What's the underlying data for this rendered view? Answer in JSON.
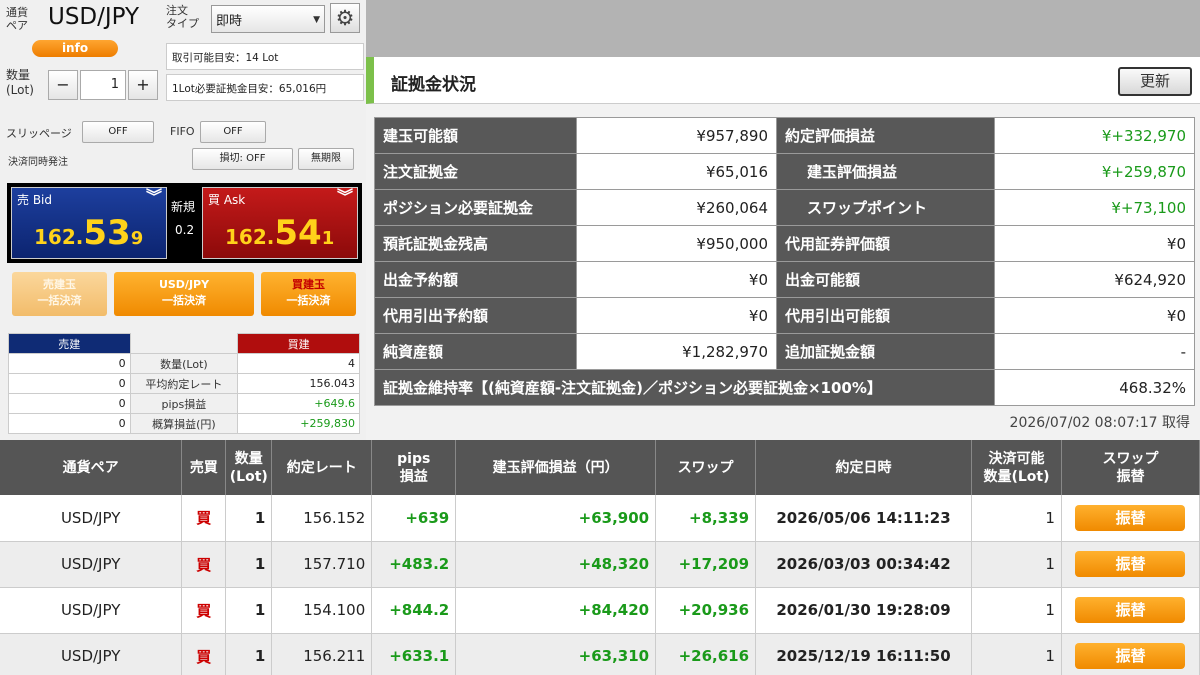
{
  "order": {
    "pair_label": "通貨\nペア",
    "pair": "USD/JPY",
    "info_label": "info",
    "order_type_label": "注文\nタイプ",
    "order_type_value": "即時",
    "tradable_lot": "取引可能目安：14 Lot",
    "required_margin": "1Lot必要証拠金目安：65,016円",
    "qty_label": "数量\n(Lot)",
    "qty_value": "1",
    "minus": "−",
    "plus": "+",
    "slippage_label": "スリッページ",
    "slippage_value": "OFF",
    "fifo_label": "FIFO",
    "fifo_value": "OFF",
    "settle_label": "決済同時発注",
    "stoploss_value": "損切: OFF",
    "expiry_value": "無期限"
  },
  "quote": {
    "bid_title": "売 Bid",
    "bid_base": "162.",
    "bid_big": "53",
    "bid_small": "9",
    "ask_title": "買 Ask",
    "ask_base": "162.",
    "ask_big": "54",
    "ask_small": "1",
    "new_label": "新規",
    "spread": "0.2"
  },
  "bulk": {
    "sell_l1": "売建玉",
    "sell_l2": "一括決済",
    "pair_l1": "USD/JPY",
    "pair_l2": "一括決済",
    "buy_l1": "買建玉",
    "buy_l2": "一括決済"
  },
  "summary": {
    "sell_header": "売建",
    "buy_header": "買建",
    "rows": [
      {
        "sell": "0",
        "label": "数量(Lot)",
        "buy": "4"
      },
      {
        "sell": "0",
        "label": "平均約定レート",
        "buy": "156.043"
      },
      {
        "sell": "0",
        "label": "pips損益",
        "buy": "+649.6"
      },
      {
        "sell": "0",
        "label": "概算損益(円)",
        "buy": "+259,830"
      }
    ]
  },
  "margin": {
    "title": "証拠金状況",
    "refresh": "更新",
    "rows": [
      {
        "l1": "建玉可能額",
        "v1": "¥957,890",
        "l2": "約定評価損益",
        "v2": "¥+332,970"
      },
      {
        "l1": "注文証拠金",
        "v1": "¥65,016",
        "l2": "建玉評価損益",
        "v2": "¥+259,870"
      },
      {
        "l1": "ポジション必要証拠金",
        "v1": "¥260,064",
        "l2": "スワップポイント",
        "v2": "¥+73,100"
      },
      {
        "l1": "預託証拠金残高",
        "v1": "¥950,000",
        "l2": "代用証券評価額",
        "v2": "¥0"
      },
      {
        "l1": "出金予約額",
        "v1": "¥0",
        "l2": "出金可能額",
        "v2": "¥624,920"
      },
      {
        "l1": "代用引出予約額",
        "v1": "¥0",
        "l2": "代用引出可能額",
        "v2": "¥0"
      },
      {
        "l1": "純資産額",
        "v1": "¥1,282,970",
        "l2": "追加証拠金額",
        "v2": "-"
      }
    ],
    "ratio_label": "証拠金維持率【(純資産額-注文証拠金)／ポジション必要証拠金×100%】",
    "ratio_value": "468.32%",
    "updated": "2026/07/02 08:07:17 取得"
  },
  "positions": {
    "headers": [
      "通貨ペア",
      "売買",
      "数量\n(Lot)",
      "約定レート",
      "pips\n損益",
      "建玉評価損益（円）",
      "スワップ",
      "約定日時",
      "決済可能\n数量(Lot)",
      "スワップ\n振替"
    ],
    "rows": [
      {
        "pair": "USD/JPY",
        "side": "買",
        "qty": "1",
        "rate": "156.152",
        "pips": "+639",
        "pl": "+63,900",
        "swap": "+8,339",
        "date": "2026/05/06 14:11:23",
        "avail": "1",
        "btn": "振替"
      },
      {
        "pair": "USD/JPY",
        "side": "買",
        "qty": "1",
        "rate": "157.710",
        "pips": "+483.2",
        "pl": "+48,320",
        "swap": "+17,209",
        "date": "2026/03/03 00:34:42",
        "avail": "1",
        "btn": "振替"
      },
      {
        "pair": "USD/JPY",
        "side": "買",
        "qty": "1",
        "rate": "154.100",
        "pips": "+844.2",
        "pl": "+84,420",
        "swap": "+20,936",
        "date": "2026/01/30 19:28:09",
        "avail": "1",
        "btn": "振替"
      },
      {
        "pair": "USD/JPY",
        "side": "買",
        "qty": "1",
        "rate": "156.211",
        "pips": "+633.1",
        "pl": "+63,310",
        "swap": "+26,616",
        "date": "2025/12/19 16:11:50",
        "avail": "1",
        "btn": "振替"
      }
    ]
  },
  "colors": {
    "buy": "#cc0000",
    "sell": "#0f2b75",
    "profit": "#1a9a1a",
    "accent": "#f08a00",
    "header_green": "#7cc04a"
  }
}
